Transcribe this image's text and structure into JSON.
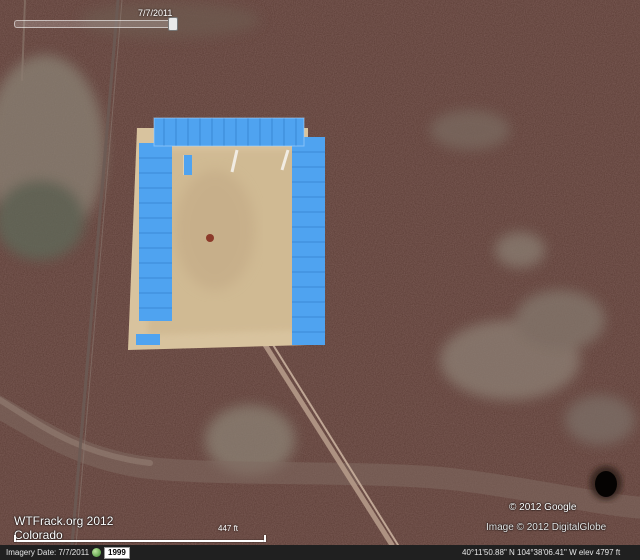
{
  "time_slider": {
    "date": "7/7/2011",
    "position": 1.0
  },
  "watermark": {
    "copyright_google": "© 2012 Google",
    "copyright_imagery": "Image © 2012 DigitalGlobe",
    "credit_line1": "WTFrack.org 2012",
    "credit_line2": "Colorado"
  },
  "scale": {
    "label": "447 ft"
  },
  "status_bar": {
    "imagery_date": "Imagery Date: 7/7/2011",
    "year": "1999",
    "coords": "40°11'50.88\" N 104°38'06.41\" W elev 4797 ft",
    "history_icon": "clock-history-icon"
  },
  "colors": {
    "ground": "#5a3a33",
    "pad": "#d8c39e",
    "tank": "#4fa3f0",
    "road": "#b59a88"
  }
}
